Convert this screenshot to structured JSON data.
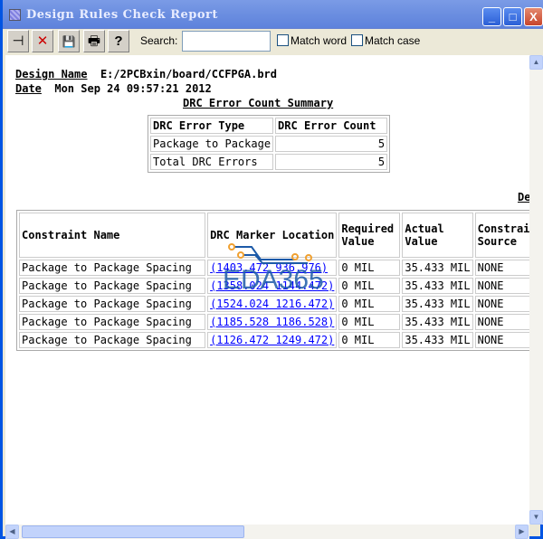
{
  "window": {
    "title": "Design Rules Check Report",
    "min": "_",
    "max": "□",
    "close": "X"
  },
  "toolbar": {
    "pin": "⊣",
    "delete": "✕",
    "save": "💾",
    "print": "🖶",
    "help": "?",
    "search_label": "Search:",
    "search_value": "",
    "match_word": "Match word",
    "match_case": "Match case"
  },
  "report": {
    "design_name_label": "Design Name",
    "design_name": "E:/2PCBxin/board/CCFPGA.brd",
    "date_label": "Date",
    "date": "Mon Sep 24 09:57:21 2012",
    "summary_title": "DRC Error Count Summary",
    "summary_headers": [
      "DRC Error Type",
      "DRC Error Count"
    ],
    "summary_rows": [
      [
        "Package to Package",
        "5"
      ],
      [
        "Total DRC Errors",
        "5"
      ]
    ],
    "details_title_partial": "De",
    "detail_headers": [
      "Constraint Name",
      "DRC Marker Location",
      "Required Value",
      "Actual Value",
      "Constraint Source"
    ],
    "detail_rows": [
      [
        "Package to Package Spacing",
        "(1403.472 936.976)",
        "0 MIL",
        "35.433 MIL",
        "NONE"
      ],
      [
        "Package to Package Spacing",
        "(1358.024 1144.472)",
        "0 MIL",
        "35.433 MIL",
        "NONE"
      ],
      [
        "Package to Package Spacing",
        "(1524.024 1216.472)",
        "0 MIL",
        "35.433 MIL",
        "NONE"
      ],
      [
        "Package to Package Spacing",
        "(1185.528 1186.528)",
        "0 MIL",
        "35.433 MIL",
        "NONE"
      ],
      [
        "Package to Package Spacing",
        "(1126.472 1249.472)",
        "0 MIL",
        "35.433 MIL",
        "NONE"
      ]
    ]
  },
  "watermark": "EDA365"
}
